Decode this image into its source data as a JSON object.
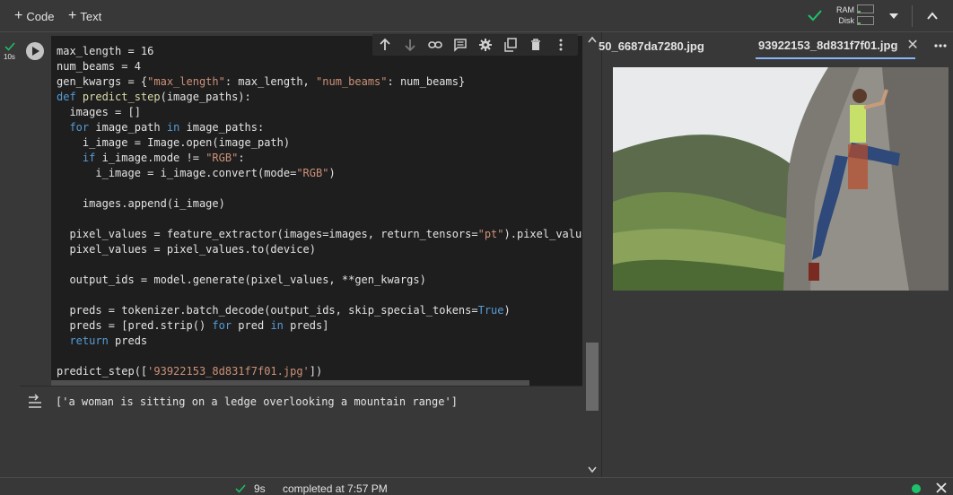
{
  "toolbar": {
    "code_label": "Code",
    "text_label": "Text",
    "ram_label": "RAM",
    "disk_label": "Disk",
    "ram_usage": 0.15,
    "disk_usage": 0.15
  },
  "cell": {
    "exec_time": "10s",
    "code_lines": [
      [
        {
          "t": "max_length = 16",
          "c": ""
        }
      ],
      [
        {
          "t": "num_beams = 4",
          "c": ""
        }
      ],
      [
        {
          "t": "gen_kwargs = {",
          "c": ""
        },
        {
          "t": "\"max_length\"",
          "c": "s"
        },
        {
          "t": ": max_length, ",
          "c": ""
        },
        {
          "t": "\"num_beams\"",
          "c": "s"
        },
        {
          "t": ": num_beams}",
          "c": ""
        }
      ],
      [
        {
          "t": "def ",
          "c": "k"
        },
        {
          "t": "predict_step",
          "c": "f"
        },
        {
          "t": "(image_paths):",
          "c": ""
        }
      ],
      [
        {
          "t": "  images = []",
          "c": ""
        }
      ],
      [
        {
          "t": "  ",
          "c": ""
        },
        {
          "t": "for",
          "c": "k"
        },
        {
          "t": " image_path ",
          "c": ""
        },
        {
          "t": "in",
          "c": "k"
        },
        {
          "t": " image_paths:",
          "c": ""
        }
      ],
      [
        {
          "t": "    i_image = Image.open(image_path)",
          "c": ""
        }
      ],
      [
        {
          "t": "    ",
          "c": ""
        },
        {
          "t": "if",
          "c": "k"
        },
        {
          "t": " i_image.mode != ",
          "c": ""
        },
        {
          "t": "\"RGB\"",
          "c": "s"
        },
        {
          "t": ":",
          "c": ""
        }
      ],
      [
        {
          "t": "      i_image = i_image.convert(mode=",
          "c": ""
        },
        {
          "t": "\"RGB\"",
          "c": "s"
        },
        {
          "t": ")",
          "c": ""
        }
      ],
      [
        {
          "t": "",
          "c": ""
        }
      ],
      [
        {
          "t": "    images.append(i_image)",
          "c": ""
        }
      ],
      [
        {
          "t": "",
          "c": ""
        }
      ],
      [
        {
          "t": "  pixel_values = feature_extractor(images=images, return_tensors=",
          "c": ""
        },
        {
          "t": "\"pt\"",
          "c": "s"
        },
        {
          "t": ").pixel_values",
          "c": ""
        }
      ],
      [
        {
          "t": "  pixel_values = pixel_values.to(device)",
          "c": ""
        }
      ],
      [
        {
          "t": "",
          "c": ""
        }
      ],
      [
        {
          "t": "  output_ids = model.generate(pixel_values, **gen_kwargs)",
          "c": ""
        }
      ],
      [
        {
          "t": "",
          "c": ""
        }
      ],
      [
        {
          "t": "  preds = tokenizer.batch_decode(output_ids, skip_special_tokens=",
          "c": ""
        },
        {
          "t": "True",
          "c": "k"
        },
        {
          "t": ")",
          "c": ""
        }
      ],
      [
        {
          "t": "  preds = [pred.strip() ",
          "c": ""
        },
        {
          "t": "for",
          "c": "k"
        },
        {
          "t": " pred ",
          "c": ""
        },
        {
          "t": "in",
          "c": "k"
        },
        {
          "t": " preds]",
          "c": ""
        }
      ],
      [
        {
          "t": "  ",
          "c": ""
        },
        {
          "t": "return",
          "c": "k"
        },
        {
          "t": " preds",
          "c": ""
        }
      ],
      [
        {
          "t": "",
          "c": ""
        }
      ],
      [
        {
          "t": "predict_step([",
          "c": ""
        },
        {
          "t": "'93922153_8d831f7f01.jpg'",
          "c": "s"
        },
        {
          "t": "])",
          "c": ""
        }
      ]
    ],
    "cell_toolbar_icons": [
      "arrow-up-icon",
      "arrow-down-icon",
      "link-icon",
      "comment-icon",
      "gear-icon",
      "mirror-icon",
      "trash-icon",
      "more-vert-icon"
    ],
    "output_text": "['a woman is sitting on a ledge overlooking a mountain range']"
  },
  "right_pane": {
    "tab_inactive": "50_6687da7280.jpg",
    "tab_active": "93922153_8d831f7f01.jpg"
  },
  "statusbar": {
    "duration": "9s",
    "status_text": "completed at 7:57 PM"
  },
  "colors": {
    "background": "#383838",
    "code_bg": "#1e1e1e",
    "keyword": "#569cd6",
    "string": "#ce9178",
    "accent_tab": "#8ab4f8",
    "success": "#1ec26b"
  }
}
